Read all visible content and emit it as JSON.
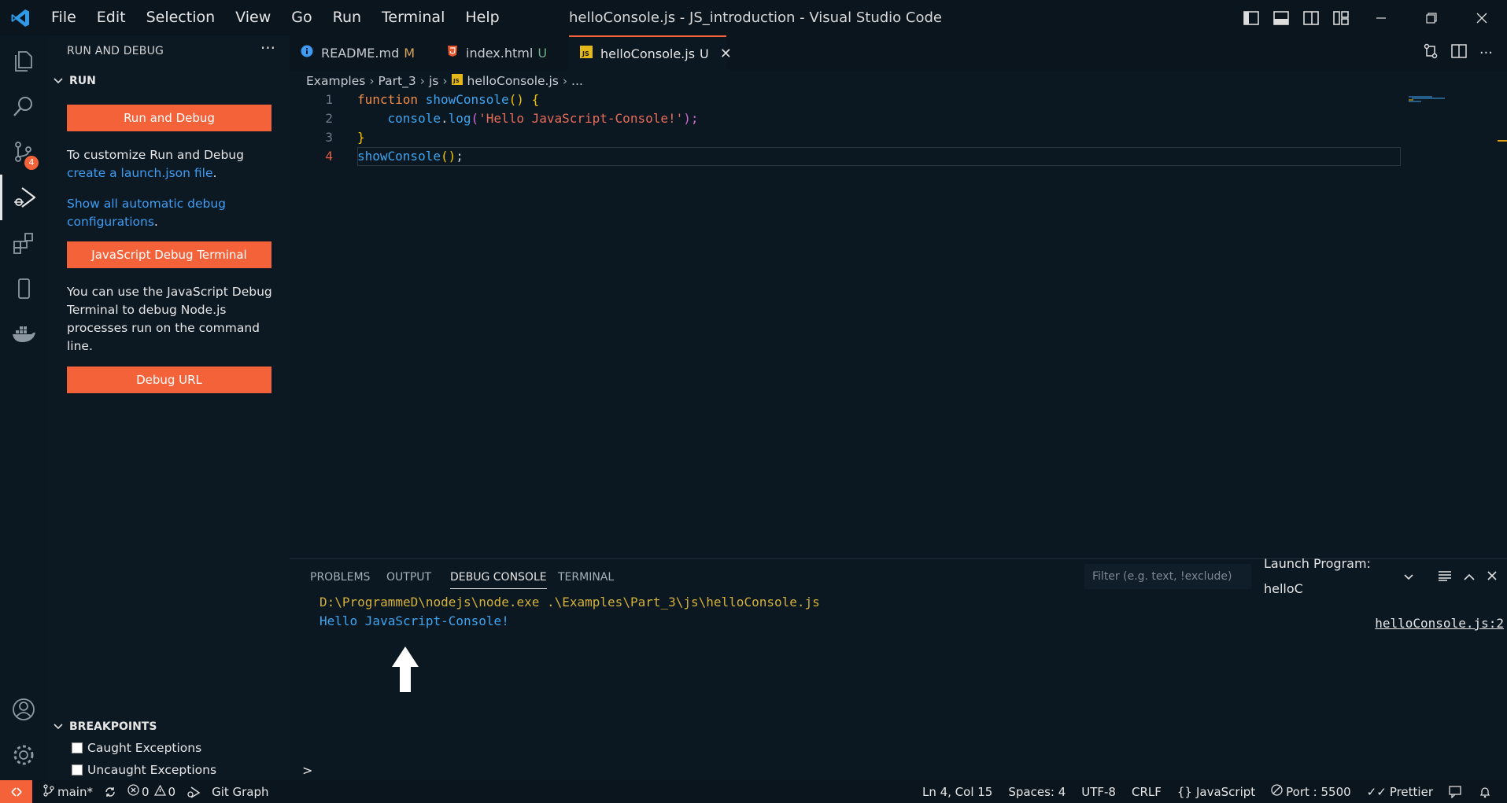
{
  "window": {
    "title": "helloConsole.js - JS_introduction - Visual Studio Code"
  },
  "menu": [
    "File",
    "Edit",
    "Selection",
    "View",
    "Go",
    "Run",
    "Terminal",
    "Help"
  ],
  "activity_bar": {
    "source_control_badge": "4"
  },
  "sidebar": {
    "title": "RUN AND DEBUG",
    "run_section": "RUN",
    "run_and_debug_button": "Run and Debug",
    "customize_text": "To customize Run and Debug",
    "create_link": "create a launch.json file",
    "period": ".",
    "show_all_link": "Show all automatic debug configurations",
    "js_debug_terminal_button": "JavaScript Debug Terminal",
    "terminal_hint": "You can use the JavaScript Debug Terminal to debug Node.js processes run on the command line.",
    "debug_url_button": "Debug URL",
    "breakpoints_section": "BREAKPOINTS",
    "breakpoints": [
      "Caught Exceptions",
      "Uncaught Exceptions"
    ]
  },
  "tabs": [
    {
      "icon": "info-icon",
      "label": "README.md",
      "status": "M"
    },
    {
      "icon": "html5-icon",
      "label": "index.html",
      "status": "U"
    },
    {
      "icon": "js-icon",
      "label": "helloConsole.js",
      "status": "U"
    }
  ],
  "breadcrumb": [
    "Examples",
    "Part_3",
    "js",
    "helloConsole.js",
    "..."
  ],
  "code": {
    "line_numbers": [
      "1",
      "2",
      "3",
      "4"
    ],
    "l1_kw": "function",
    "l1_fn": "showConsole",
    "l1_paren": "()",
    "l1_brace": "{",
    "l2_obj": "console",
    "l2_dot": ".",
    "l2_method": "log",
    "l2_open": "(",
    "l2_str": "'Hello JavaScript-Console!'",
    "l2_close": ");",
    "l3_brace": "}",
    "l4_call": "showConsole",
    "l4_paren": "()",
    "l4_semi": ";"
  },
  "panel": {
    "tabs": [
      "PROBLEMS",
      "OUTPUT",
      "DEBUG CONSOLE",
      "TERMINAL"
    ],
    "filter_placeholder": "Filter (e.g. text, !exclude)",
    "launch_config": "Launch Program: helloC",
    "output_cmd": "D:\\ProgrammeD\\nodejs\\node.exe .\\Examples\\Part_3\\js\\helloConsole.js",
    "output_msg": "Hello JavaScript-Console!",
    "source_link": "helloConsole.js:2",
    "prompt": ">"
  },
  "statusbar": {
    "branch": "main*",
    "errors": "0",
    "warnings": "0",
    "git_graph": "Git Graph",
    "position": "Ln 4, Col 15",
    "spaces": "Spaces: 4",
    "encoding": "UTF-8",
    "eol": "CRLF",
    "language": "JavaScript",
    "port": "Port : 5500",
    "prettier": "Prettier"
  },
  "colors": {
    "accent": "#f4623a",
    "link": "#3f9cf2",
    "background": "#0b1822"
  }
}
